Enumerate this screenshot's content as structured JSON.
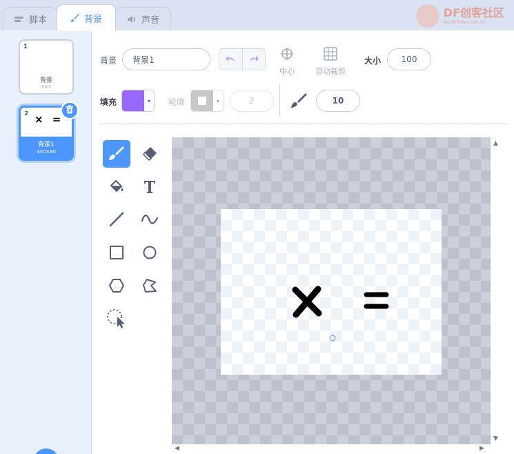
{
  "tabs": [
    {
      "label": "脚本",
      "icon": "code-icon"
    },
    {
      "label": "背景",
      "icon": "brush-icon"
    },
    {
      "label": "声音",
      "icon": "speaker-icon"
    }
  ],
  "watermark": {
    "brand": "DF创客社区",
    "url": "mc.DFRobot.com.cn"
  },
  "costumes": [
    {
      "number": "1",
      "name": "背景",
      "size": "1×1"
    },
    {
      "number": "2",
      "name": "背景1",
      "size": "140×80",
      "thumb_text": "×  ="
    }
  ],
  "toolbar": {
    "name_label": "背景",
    "name_value": "背景1",
    "center_label": "中心",
    "crop_label": "自动裁剪",
    "size_label": "大小",
    "size_value": "100",
    "fill_label": "填充",
    "outline_label": "轮廓",
    "outline_width": "2",
    "brush_size": "10"
  },
  "colors": {
    "accent": "#4c97ff",
    "fill_color": "#9966ff",
    "outline_color": "#a3a3a3"
  },
  "tools": [
    "brush-tool",
    "eraser-tool",
    "fill-tool",
    "text-tool",
    "line-tool",
    "curve-tool",
    "rectangle-tool",
    "circle-tool",
    "polygon-tool",
    "reshape-tool",
    "select-tool"
  ],
  "canvas": {
    "content": "× ="
  }
}
